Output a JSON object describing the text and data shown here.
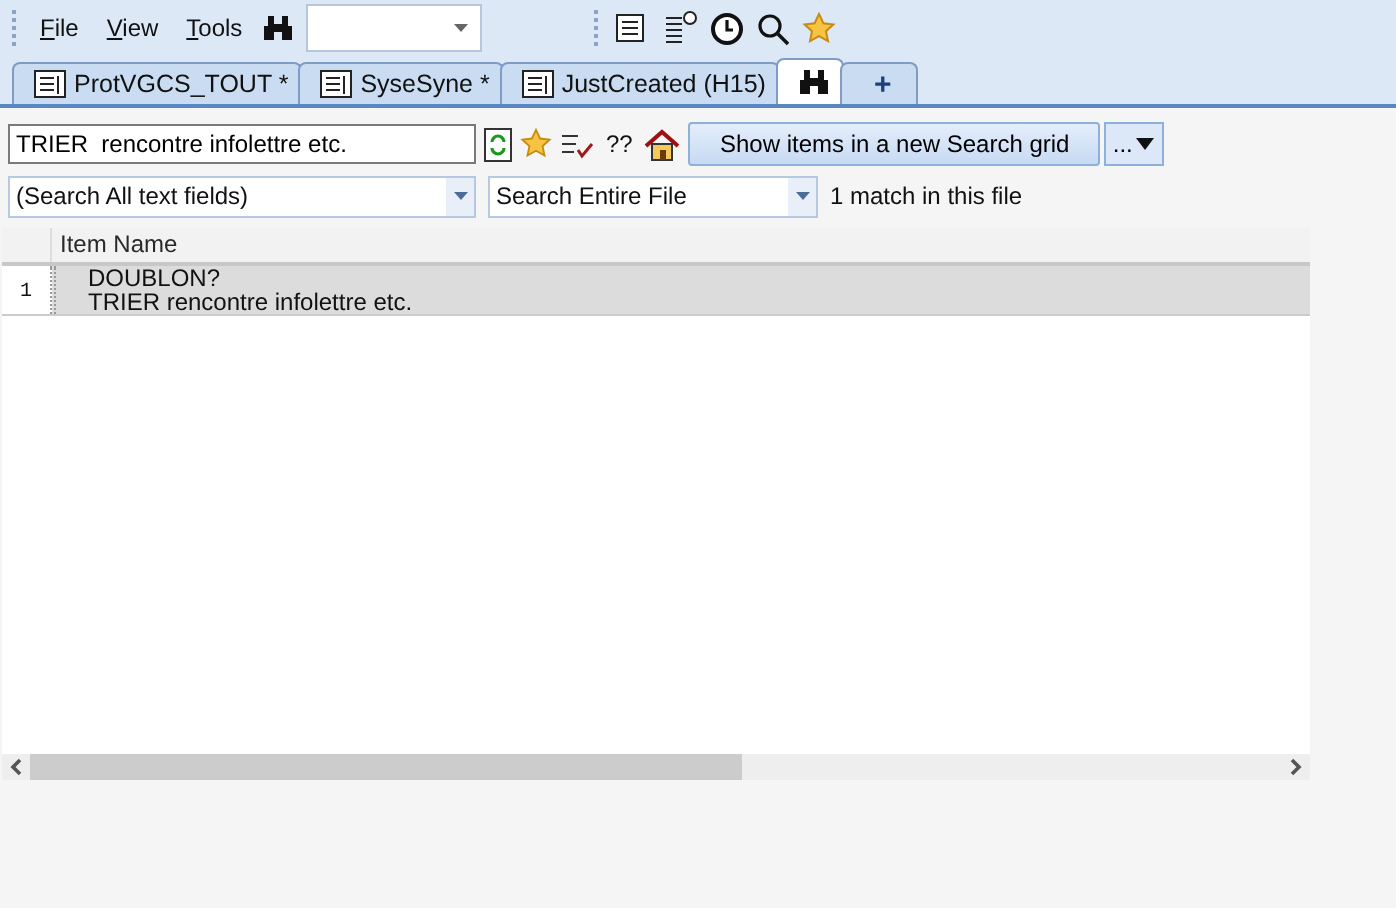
{
  "menu": [
    {
      "label": "File"
    },
    {
      "label": "View"
    },
    {
      "label": "Tools"
    }
  ],
  "tabs": [
    {
      "label": "ProtVGCS_TOUT *",
      "kind": "doc",
      "selected": false
    },
    {
      "label": "SyseSyne *",
      "kind": "doc",
      "selected": false
    },
    {
      "label": "JustCreated (H15)",
      "kind": "doc",
      "selected": false
    },
    {
      "kind": "search",
      "selected": true
    },
    {
      "label": "+",
      "kind": "add",
      "selected": false
    }
  ],
  "search": {
    "value": "TRIER  rencontre infolettre etc.",
    "help": "??",
    "show_button": "Show items in a new Search grid",
    "more_button": "...",
    "field_scope": "(Search All text fields)",
    "file_scope": "Search Entire File",
    "result": "1 match in this file"
  },
  "grid": {
    "columns": [
      "Item Name"
    ],
    "rows": [
      {
        "number": "1",
        "lines": [
          "DOUBLON?",
          "TRIER  rencontre infolettre etc."
        ],
        "selected": true
      }
    ]
  }
}
